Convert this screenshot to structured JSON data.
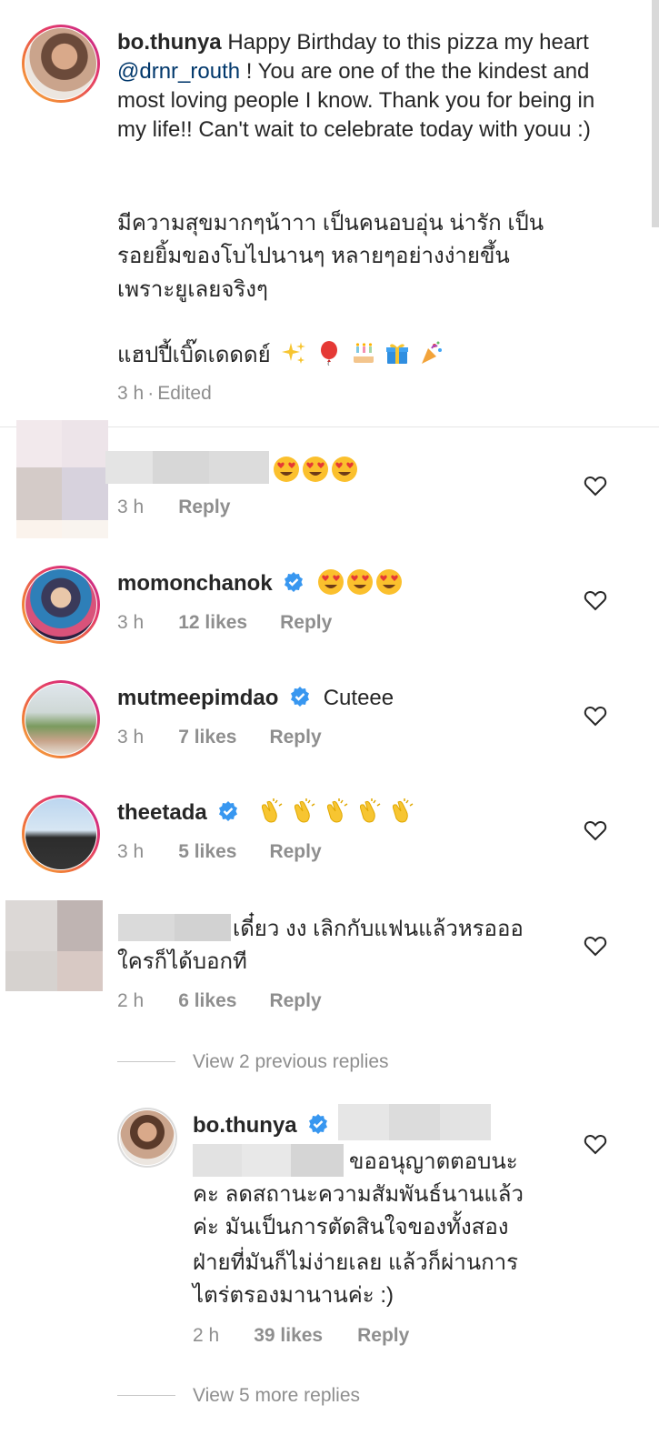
{
  "caption": {
    "username": "bo.thunya",
    "text_before": "Happy Birthday to this pizza my heart",
    "mention": "@drnr_routh",
    "text_after": "! You are one of the the kindest and most loving people I know. Thank you for being in my life!! Can't wait to celebrate today with youu :)",
    "thai_line1": "มีความสุขมากๆน้าาา เป็นคนอบอุ่น น่ารัก เป็น",
    "thai_line2": "รอยยิ้มของโบไปนานๆ หลายๆอย่างง่ายขึ้น",
    "thai_line3": "เพราะยูเลยจริงๆ",
    "thai_line4": "แฮปปี้เบิ๊ดเดดดย์",
    "emoji_names": [
      "sparkles",
      "balloon",
      "birthday-cake",
      "wrapped-gift",
      "party-popper"
    ],
    "time": "3 h",
    "edited": "Edited"
  },
  "comments": [
    {
      "time": "3 h",
      "reply": "Reply",
      "emoji_names": [
        "heart-eyes",
        "heart-eyes",
        "heart-eyes"
      ]
    },
    {
      "username": "momonchanok",
      "verified": true,
      "emoji_names": [
        "heart-eyes",
        "heart-eyes",
        "heart-eyes"
      ],
      "time": "3 h",
      "likes": "12 likes",
      "reply": "Reply"
    },
    {
      "username": "mutmeepimdao",
      "verified": true,
      "text": "Cuteee",
      "time": "3 h",
      "likes": "7 likes",
      "reply": "Reply"
    },
    {
      "username": "theetada",
      "verified": true,
      "emoji_names": [
        "clapping-hands",
        "clapping-hands",
        "clapping-hands",
        "clapping-hands",
        "clapping-hands"
      ],
      "time": "3 h",
      "likes": "5 likes",
      "reply": "Reply"
    },
    {
      "text_line1": "เดี๋ยว งง เลิกกับแฟนแล้วหรอออ",
      "text_line2": "ใครก็ได้บอกที",
      "time": "2 h",
      "likes": "6 likes",
      "reply": "Reply"
    }
  ],
  "view_previous": "View 2 previous replies",
  "reply": {
    "username": "bo.thunya",
    "verified": true,
    "line1": "ขออนุญาตตอบนะ",
    "line2": "คะ ลดสถานะความสัมพันธ์นานแล้ว",
    "line3": "ค่ะ มันเป็นการตัดสินใจของทั้งสอง",
    "line4": "ฝ่ายที่มันก็ไม่ง่ายเลย แล้วก็ผ่านการ",
    "line5": "ไตร่ตรองมานานค่ะ :)",
    "time": "2 h",
    "likes": "39 likes",
    "reply": "Reply"
  },
  "view_more": "View 5 more replies",
  "colors": {
    "text": "#262626",
    "secondary": "#8e8e8e",
    "mention": "#00376b",
    "verified": "#3897f0"
  }
}
